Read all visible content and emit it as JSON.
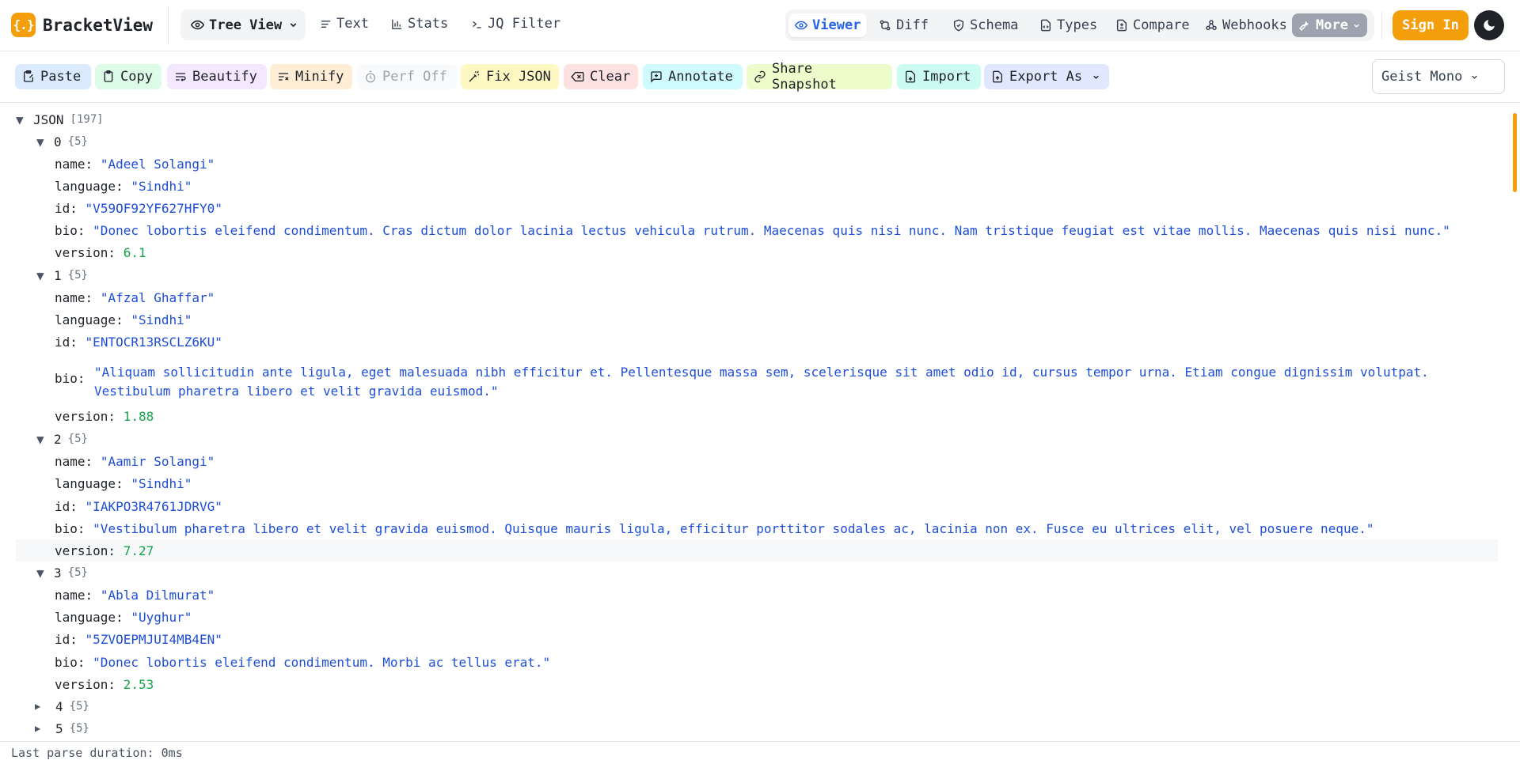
{
  "app": {
    "logo_glyph": "{.}",
    "name": "BracketView"
  },
  "header": {
    "view_select": "Tree View",
    "nav": [
      {
        "label": "Text",
        "icon": "text-lines-icon"
      },
      {
        "label": "Stats",
        "icon": "bar-chart-icon"
      },
      {
        "label": "JQ Filter",
        "icon": "terminal-icon"
      }
    ],
    "modes": [
      {
        "label": "Viewer",
        "icon": "eye-icon",
        "active": true
      },
      {
        "label": "Diff",
        "icon": "git-compare-icon"
      },
      {
        "label": "Schema",
        "icon": "shield-icon"
      },
      {
        "label": "Types",
        "icon": "file-code-icon"
      },
      {
        "label": "Compare",
        "icon": "file-diff-icon"
      },
      {
        "label": "Webhooks",
        "icon": "webhook-icon"
      },
      {
        "label": "More",
        "icon": "wrench-icon"
      }
    ],
    "sign_in": "Sign In"
  },
  "toolbar": {
    "buttons": [
      {
        "label": "Paste",
        "bg": "#dbeafe"
      },
      {
        "label": "Copy",
        "bg": "#dcfce7"
      },
      {
        "label": "Beautify",
        "bg": "#f3e8ff"
      },
      {
        "label": "Minify",
        "bg": "#ffedd5"
      },
      {
        "label": "Perf Off",
        "bg": "#f9fafb",
        "muted": true
      },
      {
        "label": "Fix JSON",
        "bg": "#fef9c3"
      },
      {
        "label": "Clear",
        "bg": "#fee2e2"
      },
      {
        "label": "Annotate",
        "bg": "#cffafe"
      },
      {
        "label": "Share Snapshot",
        "bg": "#ecfccb"
      },
      {
        "label": "Import",
        "bg": "#ccfbf1"
      },
      {
        "label": "Export As",
        "bg": "#e0e7ff"
      }
    ],
    "font_select": "Geist Mono"
  },
  "tree": {
    "root_label": "JSON",
    "root_count": "[197]",
    "items": [
      {
        "index": "0",
        "count": "{5}",
        "expanded": true,
        "name": "\"Adeel Solangi\"",
        "language": "\"Sindhi\"",
        "id": "\"V59OF92YF627HFY0\"",
        "bio": "\"Donec lobortis eleifend condimentum. Cras dictum dolor lacinia lectus vehicula rutrum. Maecenas quis nisi nunc. Nam tristique feugiat est vitae mollis. Maecenas quis nisi nunc.\"",
        "version": "6.1"
      },
      {
        "index": "1",
        "count": "{5}",
        "expanded": true,
        "name": "\"Afzal Ghaffar\"",
        "language": "\"Sindhi\"",
        "id": "\"ENTOCR13RSCLZ6KU\"",
        "bio": "\"Aliquam sollicitudin ante ligula, eget malesuada nibh efficitur et. Pellentesque massa sem, scelerisque sit amet odio id, cursus tempor urna. Etiam congue dignissim volutpat. Vestibulum pharetra libero et velit gravida euismod.\"",
        "version": "1.88"
      },
      {
        "index": "2",
        "count": "{5}",
        "expanded": true,
        "name": "\"Aamir Solangi\"",
        "language": "\"Sindhi\"",
        "id": "\"IAKPO3R4761JDRVG\"",
        "bio": "\"Vestibulum pharetra libero et velit gravida euismod. Quisque mauris ligula, efficitur porttitor sodales ac, lacinia non ex. Fusce eu ultrices elit, vel posuere neque.\"",
        "version": "7.27"
      },
      {
        "index": "3",
        "count": "{5}",
        "expanded": true,
        "name": "\"Abla Dilmurat\"",
        "language": "\"Uyghur\"",
        "id": "\"5ZVOEPMJUI4MB4EN\"",
        "bio": "\"Donec lobortis eleifend condimentum. Morbi ac tellus erat.\"",
        "version": "2.53"
      },
      {
        "index": "4",
        "count": "{5}",
        "expanded": false
      },
      {
        "index": "5",
        "count": "{5}",
        "expanded": false
      }
    ],
    "keys": {
      "name": "name:",
      "language": "language:",
      "id": "id:",
      "bio": "bio:",
      "version": "version:"
    }
  },
  "footer": {
    "status": "Last parse duration: 0ms"
  }
}
